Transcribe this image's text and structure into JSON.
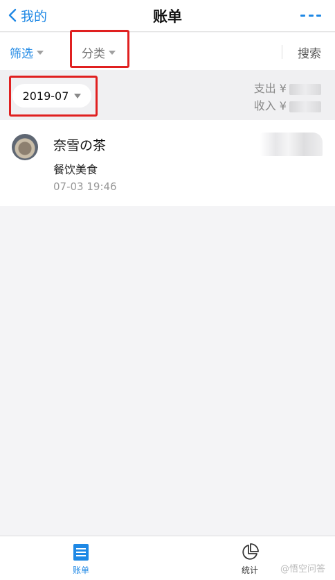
{
  "nav": {
    "back_label": "我的",
    "title": "账单"
  },
  "filter_bar": {
    "filter_label": "筛选",
    "category_label": "分类",
    "search_label": "搜索"
  },
  "month_bar": {
    "month": "2019-07",
    "expense_label": "支出 ¥",
    "income_label": "收入 ¥"
  },
  "transactions": [
    {
      "merchant": "奈雪の茶",
      "category": "餐饮美食",
      "time": "07-03  19:46"
    }
  ],
  "tabbar": {
    "tabs": [
      {
        "label": "账单",
        "active": true
      },
      {
        "label": "统计",
        "active": false
      }
    ],
    "watermark": "@悟空问答"
  },
  "colors": {
    "accent": "#1e88e5",
    "highlight_box": "#e02020"
  }
}
